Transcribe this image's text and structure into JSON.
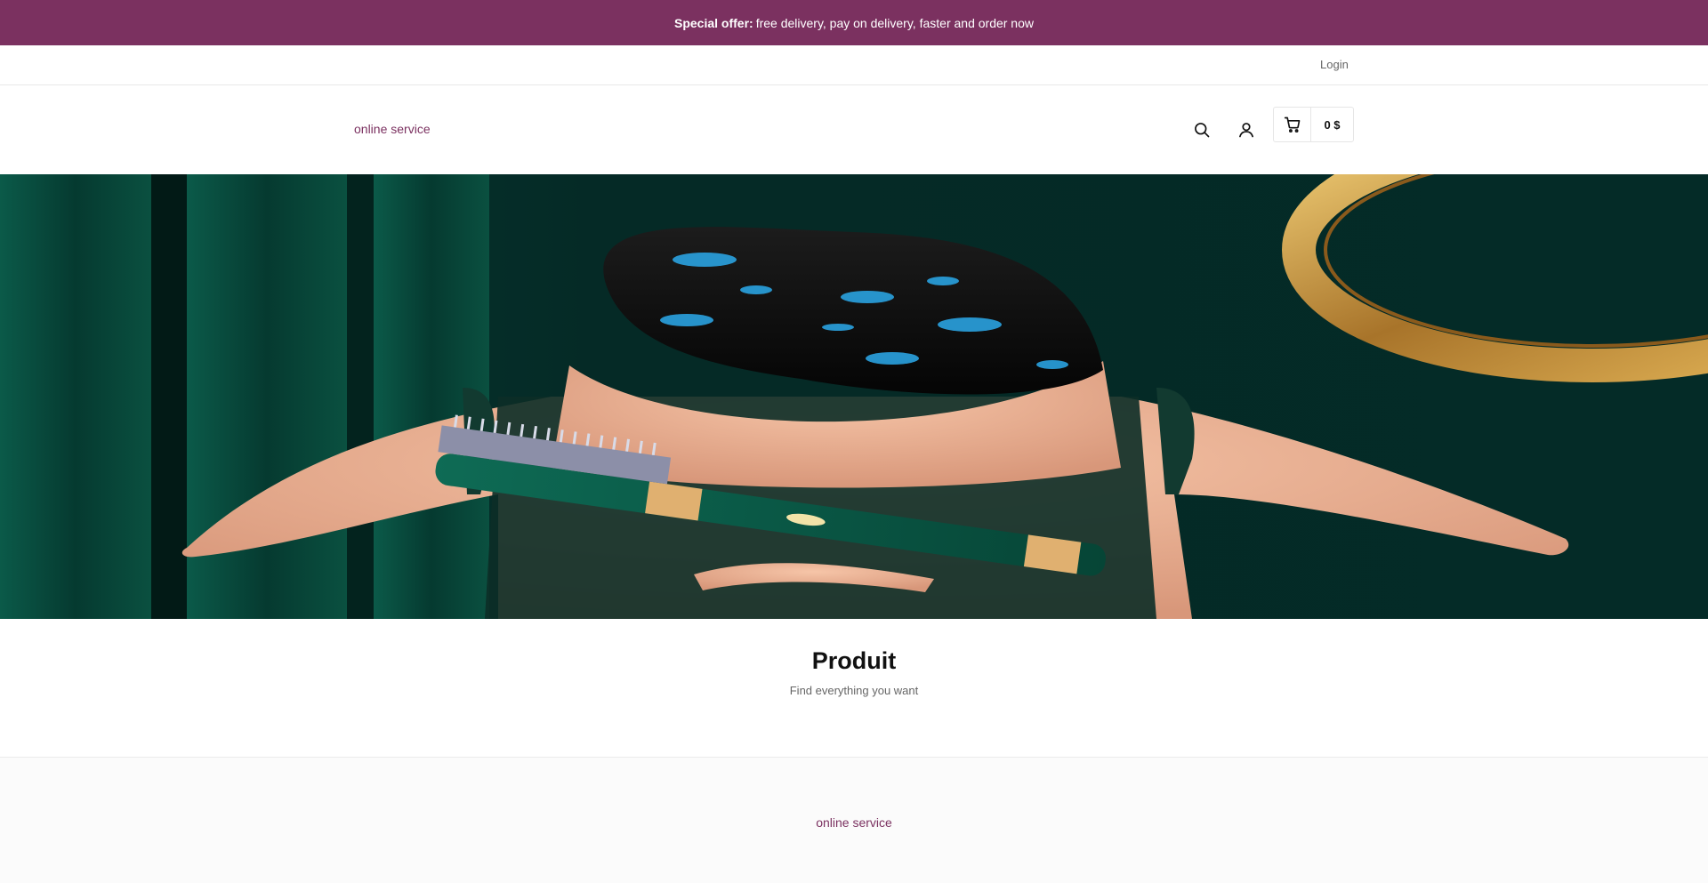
{
  "announcement": {
    "bold_text": "Special offer:",
    "text": "free delivery, pay on delivery, faster and order now"
  },
  "topbar": {
    "login_label": "Login"
  },
  "header": {
    "brand_label": "online service",
    "cart_total": "0 $",
    "icons": [
      "search-icon",
      "user-icon",
      "cart-icon"
    ]
  },
  "intro": {
    "title": "Produit",
    "subtitle": "Find everything you want"
  },
  "footer": {
    "link_label": "online service"
  },
  "colors": {
    "accent": "#7b3160",
    "hero_bg": "#04302b"
  }
}
